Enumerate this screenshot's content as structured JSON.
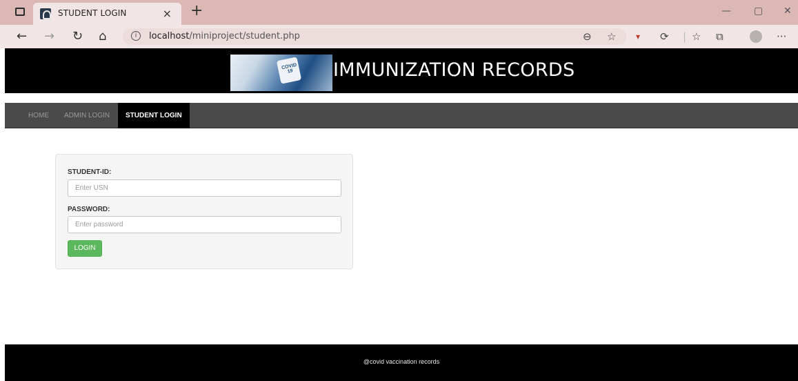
{
  "browser": {
    "tab_title": "STUDENT LOGIN",
    "tab_close": "×",
    "new_tab": "+",
    "url_host": "localhost",
    "url_path": "/miniproject/student.php",
    "colors": {
      "tabbar": "#dbb8b4",
      "toolbar": "#f1e6e5"
    }
  },
  "header": {
    "title": "IMMUNIZATION RECORDS",
    "image_icon": "covid-vaccine-banner-image"
  },
  "nav": {
    "items": [
      {
        "label": "HOME",
        "active": false
      },
      {
        "label": "ADMIN LOGIN",
        "active": false
      },
      {
        "label": "STUDENT LOGIN",
        "active": true
      }
    ]
  },
  "form": {
    "student_id_label": "STUDENT-ID:",
    "student_id_placeholder": "Enter USN",
    "student_id_value": "",
    "password_label": "PASSWORD:",
    "password_placeholder": "Enter password",
    "password_value": "",
    "login_label": "LOGIN",
    "button_color": "#5cb85c"
  },
  "footer": {
    "text": "@covid vaccination records"
  }
}
